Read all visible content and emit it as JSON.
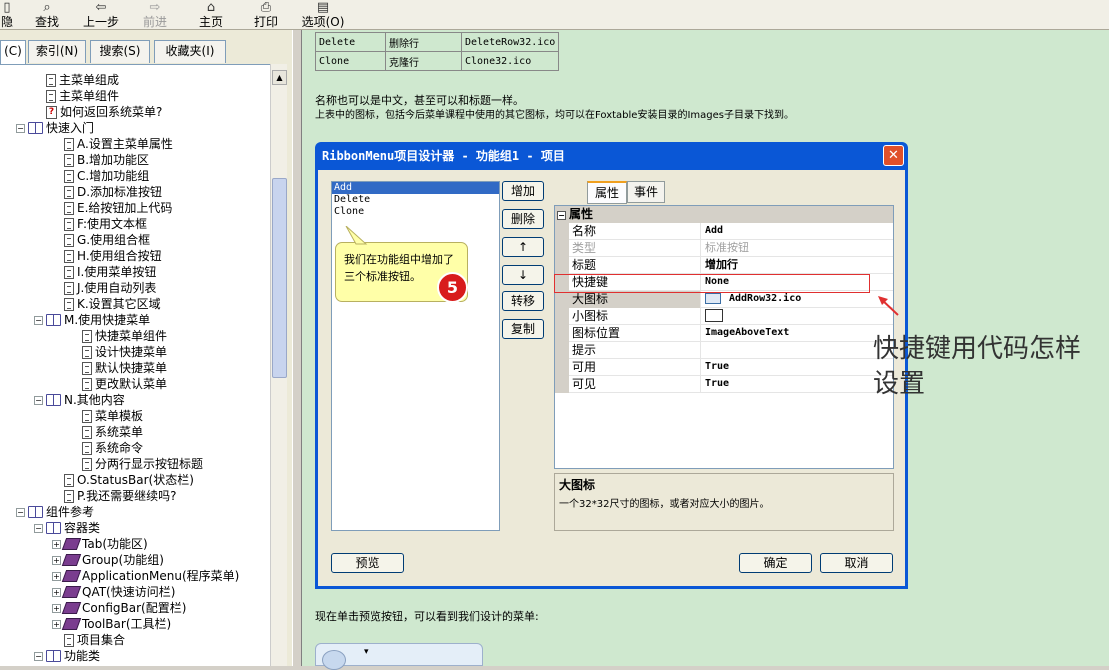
{
  "toolbar": {
    "items": [
      {
        "label": "隐",
        "icon": "hide-icon",
        "disabled": false
      },
      {
        "label": "查找",
        "icon": "find-icon",
        "disabled": false
      },
      {
        "label": "上一步",
        "icon": "back-arrow-icon",
        "disabled": false
      },
      {
        "label": "前进",
        "icon": "forward-arrow-icon",
        "disabled": true
      },
      {
        "label": "主页",
        "icon": "home-icon",
        "disabled": false
      },
      {
        "label": "打印",
        "icon": "printer-icon",
        "disabled": false
      },
      {
        "label": "选项(O)",
        "icon": "options-icon",
        "disabled": false
      }
    ]
  },
  "left_tabs": [
    "(C)",
    "索引(N)",
    "搜索(S)",
    "收藏夹(I)"
  ],
  "tree": [
    {
      "label": "主菜单组成",
      "type": "page",
      "level": 2
    },
    {
      "label": "主菜单组件",
      "type": "page",
      "level": 2
    },
    {
      "label": "如何返回系统菜单?",
      "type": "help",
      "level": 2
    },
    {
      "label": "快速入门",
      "type": "book",
      "level": 1
    },
    {
      "label": "A.设置主菜单属性",
      "type": "page",
      "level": 3
    },
    {
      "label": "B.增加功能区",
      "type": "page",
      "level": 3
    },
    {
      "label": "C.增加功能组",
      "type": "page",
      "level": 3
    },
    {
      "label": "D.添加标准按钮",
      "type": "page",
      "level": 3
    },
    {
      "label": "E.给按钮加上代码",
      "type": "page",
      "level": 3
    },
    {
      "label": "F:使用文本框",
      "type": "page",
      "level": 3
    },
    {
      "label": "G.使用组合框",
      "type": "page",
      "level": 3
    },
    {
      "label": "H.使用组合按钮",
      "type": "page",
      "level": 3
    },
    {
      "label": "I.使用菜单按钮",
      "type": "page",
      "level": 3
    },
    {
      "label": "J.使用自动列表",
      "type": "page",
      "level": 3
    },
    {
      "label": "K.设置其它区域",
      "type": "page",
      "level": 3
    },
    {
      "label": "M.使用快捷菜单",
      "type": "book",
      "level": 2
    },
    {
      "label": "快捷菜单组件",
      "type": "page",
      "level": 4
    },
    {
      "label": "设计快捷菜单",
      "type": "page",
      "level": 4
    },
    {
      "label": "默认快捷菜单",
      "type": "page",
      "level": 4
    },
    {
      "label": "更改默认菜单",
      "type": "page",
      "level": 4
    },
    {
      "label": "N.其他内容",
      "type": "book",
      "level": 2
    },
    {
      "label": "菜单模板",
      "type": "page",
      "level": 4
    },
    {
      "label": "系统菜单",
      "type": "page",
      "level": 4
    },
    {
      "label": "系统命令",
      "type": "page",
      "level": 4
    },
    {
      "label": "分两行显示按钮标题",
      "type": "page",
      "level": 4
    },
    {
      "label": "O.StatusBar(状态栏)",
      "type": "page",
      "level": 3
    },
    {
      "label": "P.我还需要继续吗?",
      "type": "page",
      "level": 3
    },
    {
      "label": "组件参考",
      "type": "book",
      "level": 1
    },
    {
      "label": "容器类",
      "type": "book",
      "level": 2
    },
    {
      "label": "Tab(功能区)",
      "type": "gem",
      "level": 3
    },
    {
      "label": "Group(功能组)",
      "type": "gem",
      "level": 3
    },
    {
      "label": "ApplicationMenu(程序菜单)",
      "type": "gem",
      "level": 3
    },
    {
      "label": "QAT(快速访问栏)",
      "type": "gem",
      "level": 3
    },
    {
      "label": "ConfigBar(配置栏)",
      "type": "gem",
      "level": 3
    },
    {
      "label": "ToolBar(工具栏)",
      "type": "gem",
      "level": 3
    },
    {
      "label": "项目集合",
      "type": "page",
      "level": 3
    },
    {
      "label": "功能类",
      "type": "book",
      "level": 2
    }
  ],
  "content": {
    "table_rows": [
      [
        "Delete",
        "删除行",
        "DeleteRow32.ico"
      ],
      [
        "Clone",
        "克隆行",
        "Clone32.ico"
      ]
    ],
    "para1": "名称也可以是中文，甚至可以和标题一样。",
    "para2": "上表中的图标，包括今后菜单课程中使用的其它图标，均可以在Foxtable安装目录的Images子目录下找到。",
    "para3": "现在单击预览按钮，可以看到我们设计的菜单:"
  },
  "dialog": {
    "title": "RibbonMenu项目设计器 - 功能组1 - 项目",
    "items": [
      "Add",
      "Delete",
      "Clone"
    ],
    "selected_index": 0,
    "side_buttons": [
      "增加",
      "删除",
      "↑",
      "↓",
      "转移",
      "复制"
    ],
    "prop_tabs": [
      "属性",
      "事件"
    ],
    "section_label": "属性",
    "properties": [
      {
        "key": "名称",
        "value": "Add",
        "muted": false
      },
      {
        "key": "类型",
        "value": "标准按钮",
        "muted": true
      },
      {
        "key": "标题",
        "value": "增加行",
        "muted": false
      },
      {
        "key": "快捷键",
        "value": "None",
        "muted": false
      },
      {
        "key": "大图标",
        "value": "AddRow32.ico",
        "muted": false
      },
      {
        "key": "小图标",
        "value": "",
        "muted": false
      },
      {
        "key": "图标位置",
        "value": "ImageAboveText",
        "muted": false
      },
      {
        "key": "提示",
        "value": "",
        "muted": false
      },
      {
        "key": "可用",
        "value": "True",
        "muted": false
      },
      {
        "key": "可见",
        "value": "True",
        "muted": false
      }
    ],
    "desc_title": "大图标",
    "desc_text": "一个32*32尺寸的图标，或者对应大小的图片。",
    "preview_button": "预览",
    "ok_button": "确定",
    "cancel_button": "取消"
  },
  "callout": {
    "text": "我们在功能组中增加了三个标准按钮。",
    "step_number": "5"
  },
  "annotation": "快捷键用代码怎样设置",
  "colors": {
    "content_bg": "#cfe8cf",
    "dialog_blue": "#0a57d6",
    "highlight_red": "#e03030",
    "badge_red": "#d81c1c"
  }
}
